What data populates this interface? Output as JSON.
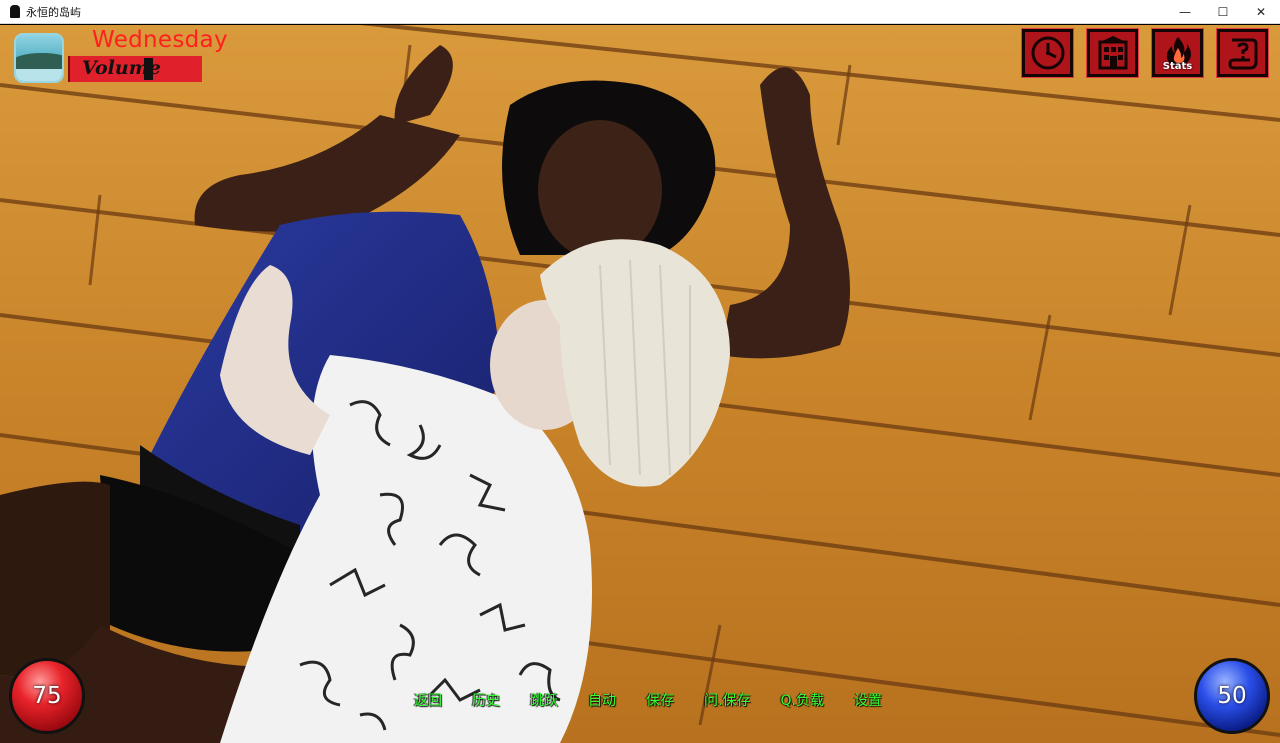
{
  "window": {
    "title": "永恒的岛屿",
    "minimize_glyph": "—",
    "maximize_glyph": "☐",
    "close_glyph": "✕"
  },
  "hud": {
    "day": "Wednesday",
    "volume_label": "Volume",
    "volume_level": 0.6,
    "icons": [
      {
        "name": "clock-icon"
      },
      {
        "name": "building-icon"
      },
      {
        "name": "stats-fire-icon",
        "label": "Stats"
      },
      {
        "name": "help-scroll-icon"
      }
    ],
    "orb_left_value": "75",
    "orb_right_value": "50"
  },
  "quick_menu": {
    "items": [
      "返回",
      "历史",
      "跳跃",
      "自动",
      "保存",
      "问.保存",
      "Q.负载",
      "设置"
    ]
  },
  "colors": {
    "accent_red": "#e0202a",
    "menu_green": "#35ff35",
    "wood": "#c9872a"
  }
}
